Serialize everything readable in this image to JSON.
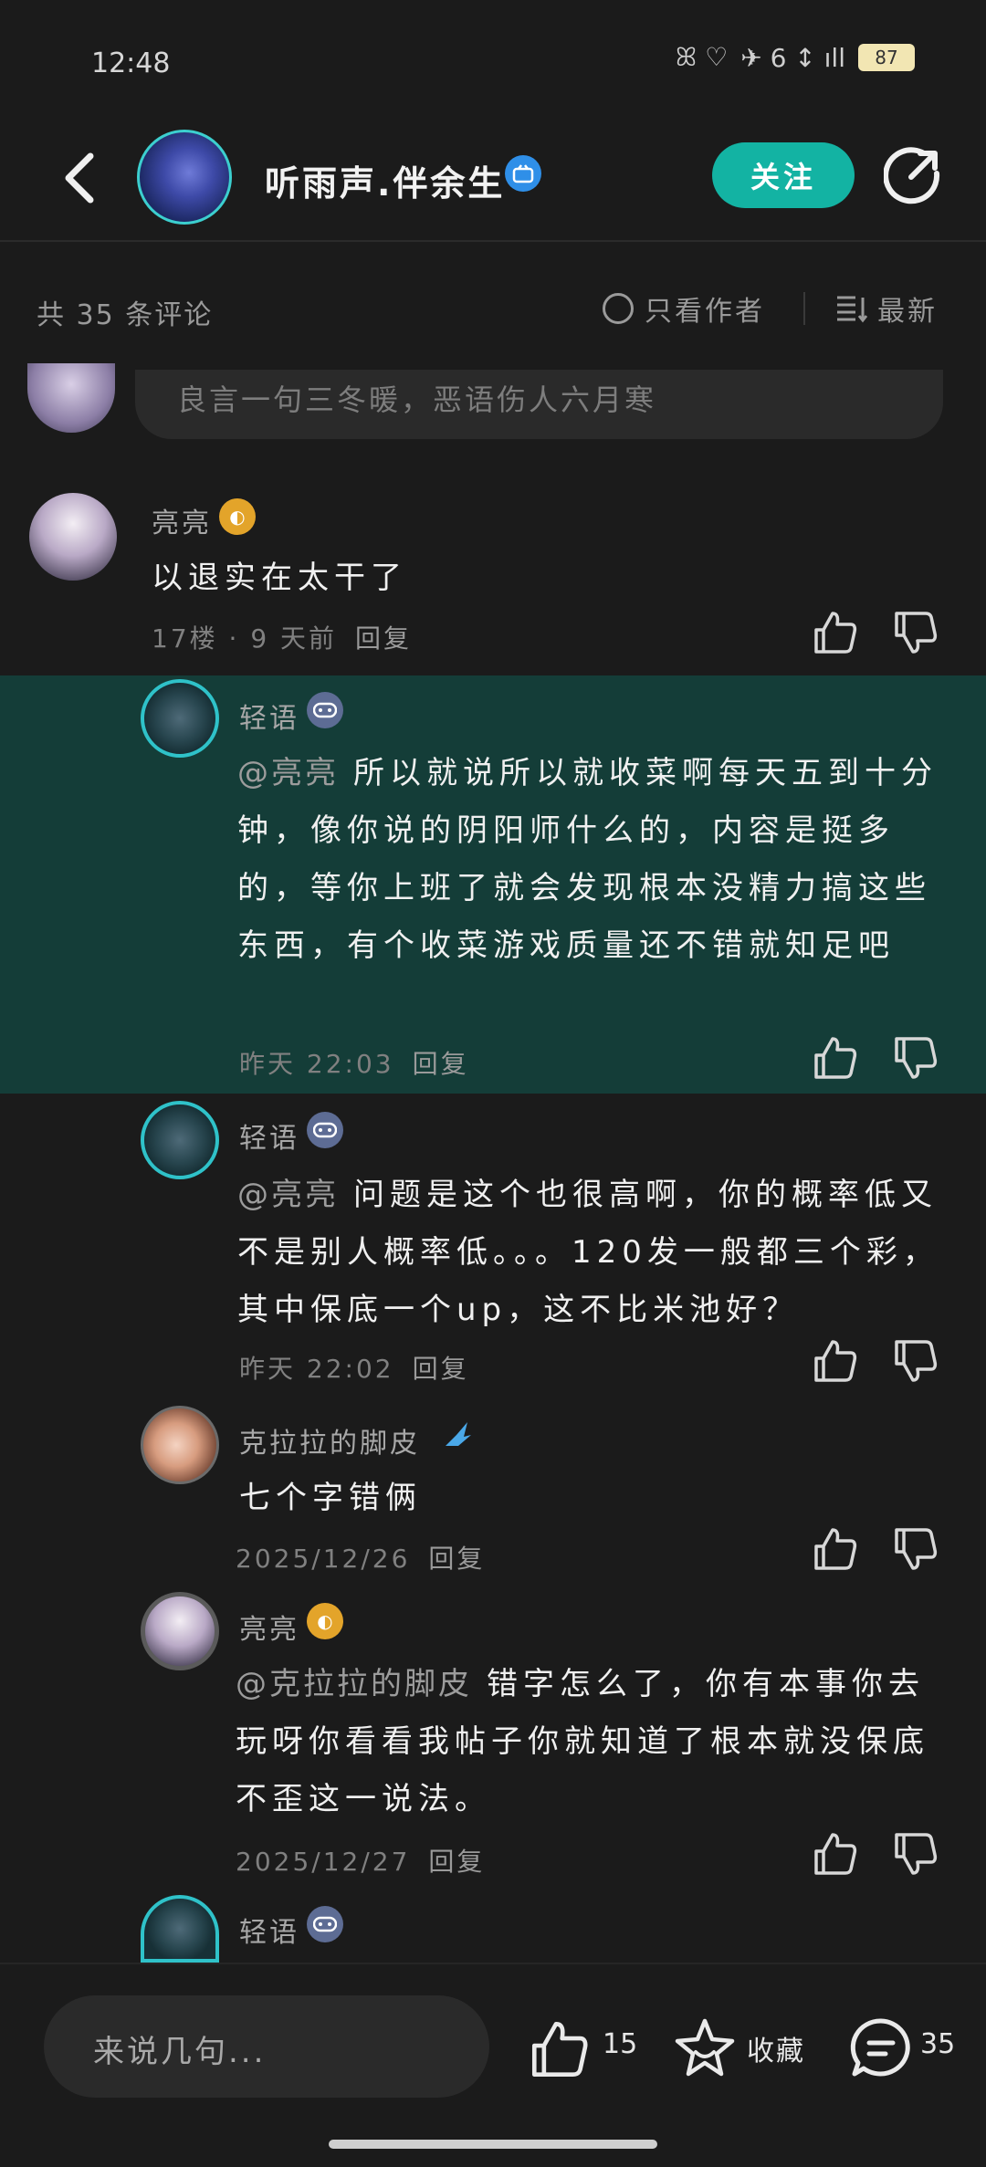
{
  "status_bar": {
    "time": "12:48",
    "battery": "87",
    "signal_text": "6"
  },
  "header": {
    "title": "听雨声.伴余生",
    "follow_label": "关注"
  },
  "comments_bar": {
    "count_text": "共 35 条评论",
    "only_author_label": "只看作者",
    "sort_label": "最新"
  },
  "top_input": {
    "placeholder": "良言一句三冬暖，恶语伤人六月寒"
  },
  "comments": [
    {
      "username": "亮亮",
      "text": "以退实在太干了",
      "meta": "17楼 · 9 天前",
      "reply_label": "回复"
    },
    {
      "username": "轻语",
      "mention": "@亮亮",
      "text": "所以就说所以就收菜啊每天五到十分钟，像你说的阴阳师什么的，内容是挺多的，等你上班了就会发现根本没精力搞这些东西，有个收菜游戏质量还不错就知足吧",
      "meta": "昨天 22:03",
      "reply_label": "回复"
    },
    {
      "username": "轻语",
      "mention": "@亮亮",
      "text": "问题是这个也很高啊，你的概率低又不是别人概率低。。。120发一般都三个彩，其中保底一个up，这不比米池好？",
      "meta": "昨天 22:02",
      "reply_label": "回复"
    },
    {
      "username": "克拉拉的脚皮",
      "text": "七个字错俩",
      "meta": "2025/12/26",
      "reply_label": "回复"
    },
    {
      "username": "亮亮",
      "mention": "@克拉拉的脚皮",
      "text": "错字怎么了，你有本事你去玩呀你看看我帖子你就知道了根本就没保底不歪这一说法。",
      "meta": "2025/12/27",
      "reply_label": "回复"
    },
    {
      "username": "轻语"
    }
  ],
  "bottom_bar": {
    "input_placeholder": "来说几句...",
    "like_count": "15",
    "favorite_label": "收藏",
    "comment_count": "35"
  },
  "colors": {
    "accent": "#13b3a3",
    "highlight_bg": "#143d38",
    "background": "#1b1b1b"
  }
}
